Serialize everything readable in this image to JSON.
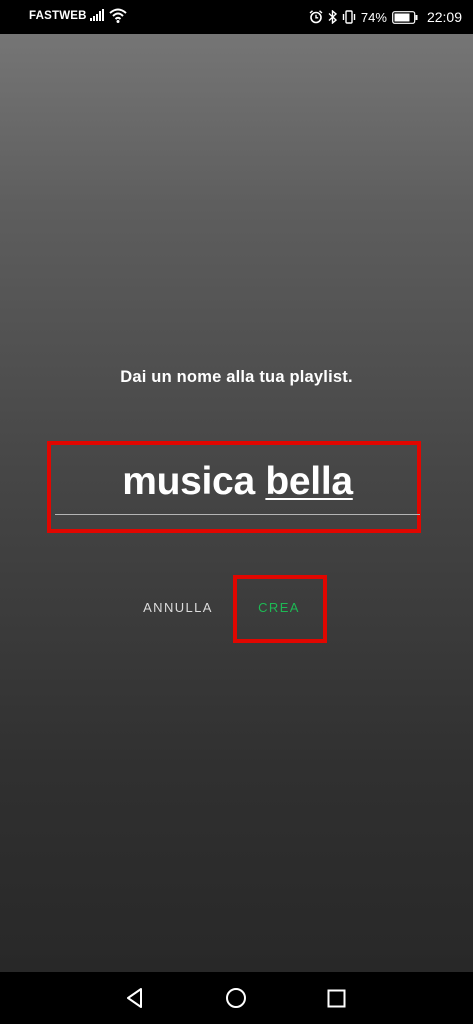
{
  "status_bar": {
    "carrier": "FASTWEB",
    "battery_percent": "74%",
    "time": "22:09",
    "icons": [
      "signal-icon",
      "wifi-icon",
      "alarm-icon",
      "bluetooth-icon",
      "vibrate-icon",
      "battery-icon"
    ]
  },
  "dialog": {
    "title": "Dai un nome alla tua playlist.",
    "name_input": {
      "value_part1": "musica",
      "value_part2": "bella"
    },
    "cancel_label": "ANNULLA",
    "create_label": "CREA",
    "accent_color": "#1db954",
    "highlight_color": "#e10600"
  },
  "nav_bar": {
    "icons": [
      "back-icon",
      "home-icon",
      "recents-icon"
    ]
  }
}
